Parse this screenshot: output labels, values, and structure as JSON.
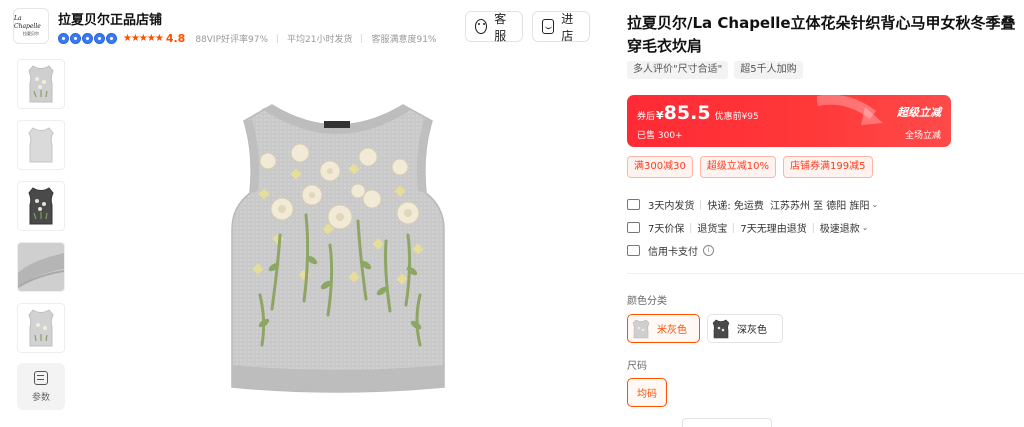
{
  "shop": {
    "logo_line1": "La Chapelle",
    "logo_line2": "拉夏贝尔",
    "name": "拉夏贝尔正品店铺",
    "stars": "★★★★★",
    "rating": "4.8",
    "metrics": [
      "88VIP好评率97%",
      "平均21小时发货",
      "客服满意度91%"
    ],
    "buttons": {
      "service": "客服",
      "enter_shop": "进店"
    }
  },
  "thumbnails": [
    {
      "name": "light-gray-vest",
      "color": "#cfcfcf"
    },
    {
      "name": "light-gray-vest-plain",
      "color": "#d9d9d9"
    },
    {
      "name": "dark-gray-vest",
      "color": "#4a4a4a"
    },
    {
      "name": "fabric-detail",
      "color": "#bdbdbd"
    },
    {
      "name": "light-gray-vest-alt",
      "color": "#d2d2d2"
    }
  ],
  "params_label": "参数",
  "product": {
    "title": "拉夏贝尔/La Chapelle立体花朵针织背心马甲女秋冬季叠穿毛衣坎肩",
    "tags": [
      "多人评价\"尺寸合适\"",
      "超5千人加购"
    ]
  },
  "price": {
    "label": "券后",
    "currency": "¥",
    "value": "85.5",
    "original": "优惠前¥95",
    "sold": "已售 300+",
    "promo_brand": "超级立减",
    "promo_sub": "全场立减",
    "accent_color": "#ff2a36"
  },
  "coupons": [
    "满300减30",
    "超级立减10%",
    "店铺券满199减5"
  ],
  "services": {
    "shipping": "3天内发货",
    "delivery": "快递: 免运费",
    "route": "江苏苏州 至 德阳 旌阳",
    "price_protect": "7天价保",
    "return_insurance": "退货宝",
    "no_reason_return": "7天无理由退货",
    "fast_refund": "极速退款",
    "credit_card": "信用卡支付"
  },
  "options": {
    "color_label": "颜色分类",
    "colors": [
      {
        "label": "米灰色",
        "selected": true
      },
      {
        "label": "深灰色",
        "selected": false
      }
    ],
    "size_label": "尺码",
    "sizes": [
      {
        "label": "均码",
        "selected": true
      }
    ]
  }
}
